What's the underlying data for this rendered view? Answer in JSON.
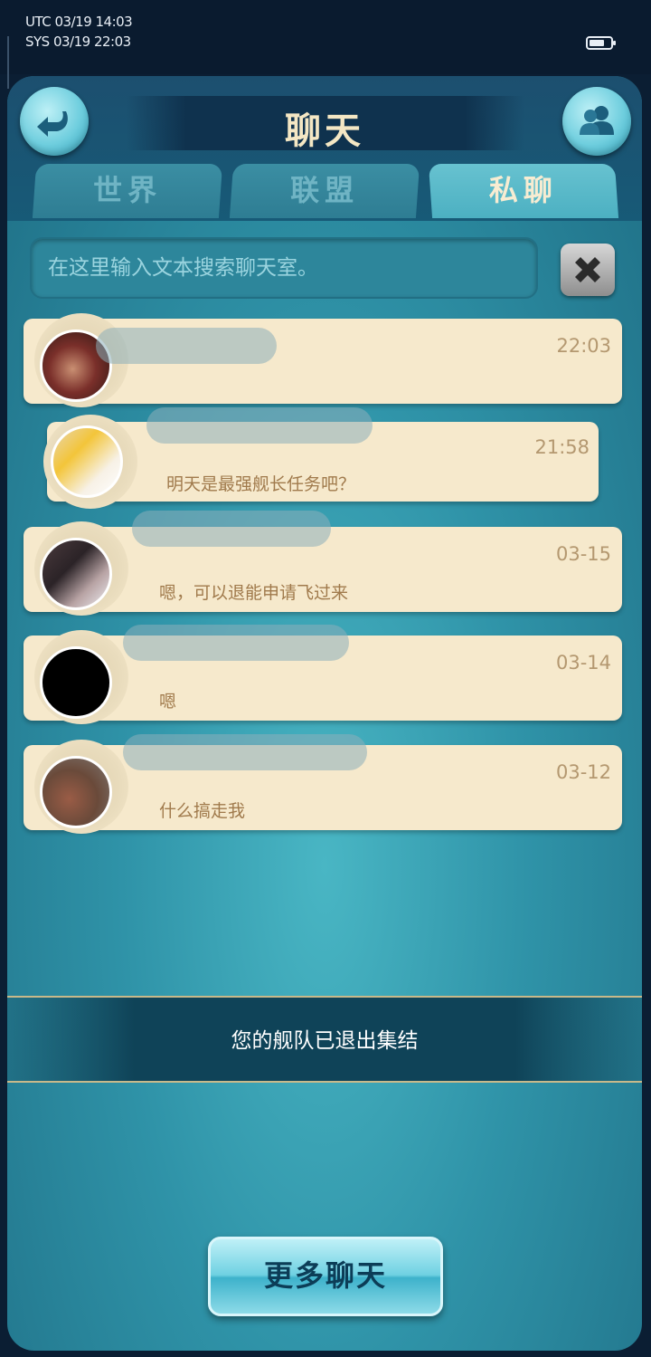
{
  "status_bar": {
    "utc": "UTC 03/19 14:03",
    "sys": "SYS 03/19 22:03",
    "battery_icon": "battery-icon"
  },
  "header": {
    "title": "聊天",
    "back_icon": "back-arrow-icon",
    "friends_icon": "friends-icon"
  },
  "tabs": [
    {
      "label": "世界",
      "active": false
    },
    {
      "label": "联盟",
      "active": false
    },
    {
      "label": "私聊",
      "active": true
    }
  ],
  "search": {
    "placeholder": "在这里输入文本搜索聊天室。",
    "clear_icon": "close-icon"
  },
  "chats": [
    {
      "time": "22:03",
      "message": ""
    },
    {
      "time": "21:58",
      "message": "明天是最强舰长任务吧？"
    },
    {
      "time": "03-15",
      "message": "嗯，可以退能申请飞过来"
    },
    {
      "time": "03-14",
      "message": "嗯"
    },
    {
      "time": "03-12",
      "message": "什么搞走我"
    }
  ],
  "notice": {
    "text": "您的舰队已退出集结"
  },
  "more_button": {
    "label": "更多聊天"
  },
  "colors": {
    "accent": "#4cb0c2",
    "card": "#f6e9cc",
    "title": "#f4e7c4"
  }
}
